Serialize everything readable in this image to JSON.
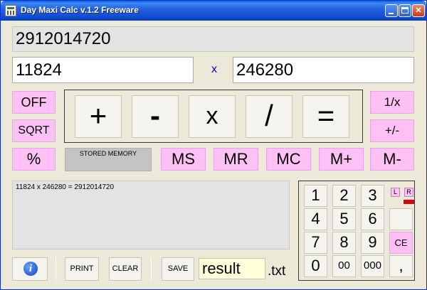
{
  "window": {
    "title": "Day Maxi Calc  v.1.2 Freeware"
  },
  "display": {
    "result": "2912014720",
    "operand1": "11824",
    "operator": "x",
    "operand2": "246280"
  },
  "left_buttons": {
    "off": "OFF",
    "sqrt": "SQRT",
    "percent": "%"
  },
  "right_buttons": {
    "reciprocal": "1/x",
    "negate": "+/-",
    "mem_minus": "M-"
  },
  "operators": {
    "plus": "+",
    "minus": "-",
    "multiply": "x",
    "divide": "/",
    "equals": "="
  },
  "memory": {
    "stored_label": "STORED  MEMORY",
    "ms": "MS",
    "mr": "MR",
    "mc": "MC",
    "mplus": "M+"
  },
  "history": {
    "line1": "11824 x 246280 = 2912014720"
  },
  "keypad": {
    "k1": "1",
    "k2": "2",
    "k3": "3",
    "k4": "4",
    "k5": "5",
    "k6": "6",
    "k7": "7",
    "k8": "8",
    "k9": "9",
    "k0": "0",
    "k00": "00",
    "k000": "000",
    "comma": ",",
    "ce": "CE",
    "left_toggle": "L",
    "right_toggle": "R"
  },
  "toolbar": {
    "info_icon": "i",
    "print": "PRINT",
    "clear": "CLEAR",
    "save": "SAVE",
    "filename": "result",
    "extension": ".txt"
  },
  "colors": {
    "pink_button": "#ffc0f5",
    "title_bar": "#2663e0",
    "filename_bg": "#ffffd9"
  }
}
